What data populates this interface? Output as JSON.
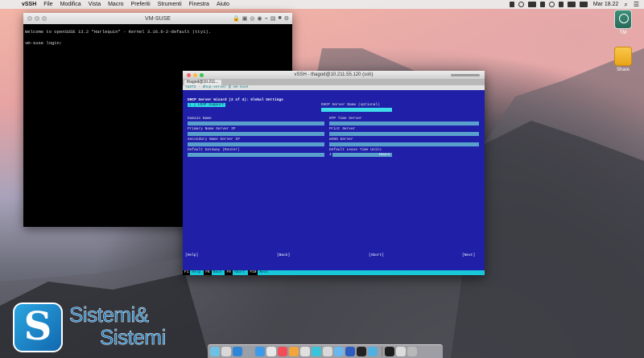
{
  "menubar": {
    "app": "vSSH",
    "items": [
      "File",
      "Modifica",
      "Vista",
      "Macro",
      "Preferiti",
      "Strumenti",
      "Finestra",
      "Aiuto"
    ],
    "clock": "Mar 18.22"
  },
  "desktop": {
    "icons": [
      {
        "label": "TM",
        "icon": "time-machine-drive-icon"
      },
      {
        "label": "Share",
        "icon": "external-drive-icon"
      }
    ]
  },
  "vm_window": {
    "title": "VM-SUSE",
    "console_lines": [
      "Welcome to openSUSE 13.2 \"Harlequin\" - Kernel 3.16.6-2-default (tty1).",
      "",
      "vm-suse login:"
    ]
  },
  "ssh_window": {
    "title": "vSSH - thagod@10.211.55.120 (ssh)",
    "tab_label": "thagod@10.211...",
    "command_line": "YaST2 - dhcp-server @ vm-suse",
    "terminal": {
      "top_strip": "YaST2 - dhcp-server @ vm-suse",
      "heading": "DHCP Server Wizard (2 of 4): Global Settings",
      "selected_option": "[ ] LDAP Support",
      "server_name_label": "DHCP Server Name (optional)",
      "left_labels": [
        "Domain Name",
        "Primary Name Server IP",
        "Secondary Name Server IP",
        "Default Gateway (Router)"
      ],
      "right_labels": [
        "NTP Time Server",
        "Print Server",
        "WINS Server",
        "Default Lease Time Units"
      ],
      "lease_value": "4",
      "lease_unit": "Hours",
      "buttons": {
        "help": "[Help]",
        "back": "[Back]",
        "abort": "[Abort]",
        "next": "[Next]"
      },
      "function_keys": [
        {
          "key": "F1",
          "label": "Help"
        },
        {
          "key": "F8",
          "label": "Back"
        },
        {
          "key": "F9",
          "label": "Abort"
        },
        {
          "key": "F10",
          "label": "Next"
        }
      ]
    }
  },
  "logo": {
    "line1": "Sistemi&",
    "line2": "Sistemi"
  },
  "dock": {
    "colors": [
      "#6ec1e4",
      "#d8d8d8",
      "#2f86d6",
      "#9aa0aa",
      "#3c9ae8",
      "#e8e8e8",
      "#f24c58",
      "#f3a43a",
      "#e0e0e0",
      "#39c4d9",
      "#d8d8d8",
      "#6ab7f0",
      "#2b5cbf",
      "#222222",
      "#52b0e0",
      "#1c1c1c",
      "#dcdcdc",
      "#b8b8b8"
    ]
  }
}
